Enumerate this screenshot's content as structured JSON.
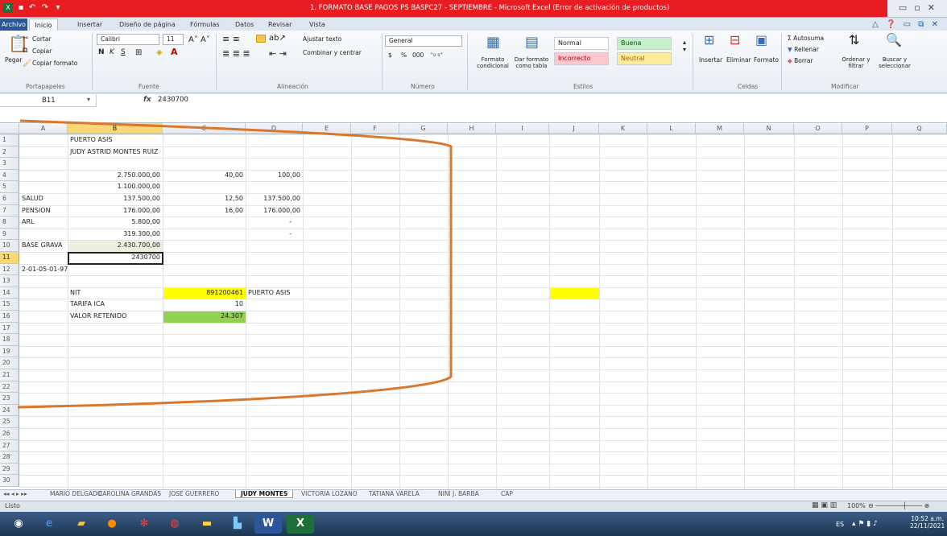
{
  "title": "1. FORMATO BASE PAGOS PS BASPC27 - SEPTIEMBRE  -  Microsoft Excel (Error de activación de productos)",
  "tabs": [
    "Archivo",
    "Inicio",
    "Insertar",
    "Diseño de página",
    "Fórmulas",
    "Datos",
    "Revisar",
    "Vista"
  ],
  "ribbon": {
    "clipboard": {
      "paste": "Pegar",
      "cut": "Cortar",
      "copy": "Copiar",
      "format_painter": "Copiar formato",
      "label": "Portapapeles"
    },
    "font": {
      "name": "Calibri",
      "size": "11",
      "label": "Fuente",
      "bold": "N",
      "italic": "K",
      "underline": "S"
    },
    "alignment": {
      "wrap": "Ajustar texto",
      "merge": "Combinar y centrar",
      "label": "Alineación"
    },
    "number": {
      "format": "General",
      "currency": "$",
      "percent": "%",
      "thousands": "000",
      "label": "Número"
    },
    "styles": {
      "cond_format": "Formato condicional",
      "as_table": "Dar formato como tabla",
      "normal": "Normal",
      "good": "Buena",
      "bad": "Incorrecto",
      "neutral": "Neutral",
      "label": "Estilos"
    },
    "cells": {
      "insert": "Insertar",
      "delete": "Eliminar",
      "format": "Formato",
      "label": "Celdas"
    },
    "editing": {
      "autosum": "Autosuma",
      "fill": "Rellenar",
      "clear": "Borrar",
      "sort": "Ordenar y filtrar",
      "find": "Buscar y seleccionar",
      "label": "Modificar"
    }
  },
  "formula_bar": {
    "namebox": "B11",
    "fx": "fx",
    "content": "2430700"
  },
  "columns": [
    "A",
    "B",
    "C",
    "D",
    "E",
    "F",
    "G",
    "H",
    "I",
    "J",
    "K",
    "L",
    "M",
    "N",
    "O",
    "P",
    "Q"
  ],
  "rows": [
    "1",
    "2",
    "3",
    "4",
    "5",
    "6",
    "7",
    "8",
    "9",
    "10",
    "11",
    "12",
    "13",
    "14",
    "15",
    "16",
    "17",
    "18",
    "19",
    "20",
    "21",
    "22",
    "23",
    "24",
    "25",
    "26",
    "27",
    "28",
    "29",
    "30"
  ],
  "cells": {
    "B1": "PUERTO ASIS",
    "B2": "JUDY ASTRID MONTES RUIZ",
    "B4": "2.750.000,00",
    "C4": "40,00",
    "D4": "100,00",
    "B5": "1.100.000,00",
    "A6": "SALUD",
    "B6": "137.500,00",
    "C6": "12,50",
    "D6": "137.500,00",
    "A7": "PENSION",
    "B7": "176.000,00",
    "C7": "16,00",
    "D7": "176.000,00",
    "A8": "ARL",
    "B8": "5.800,00",
    "D8": "-",
    "B9": "319.300,00",
    "D9": "-",
    "A10": "BASE GRAVA",
    "B10": "2.430.700,00",
    "B11": "2430700",
    "A12": "2-01-05-01-97",
    "B14": "NIT",
    "C14": "891200461",
    "D14": "PUERTO ASIS",
    "B15": "TARIFA ICA",
    "C15": "10",
    "B16": "VALOR RETENIDO",
    "C16": "24.307"
  },
  "colors": {
    "yellow": "#ffff00",
    "green": "#92d050",
    "light_green": "#ebf1de",
    "annotation": "#d9782c",
    "title": "#e81d22"
  },
  "sheet_tabs": [
    "MARIO DELGADO",
    "CAROLINA GRANDAS",
    "JOSE GUERRERO",
    "JUDY MONTES",
    "VICTORIA LOZANO",
    "TATIANA VARELA",
    "NINI J. BARBA",
    "CAP"
  ],
  "status": {
    "ready": "Listo",
    "zoom": "100%"
  },
  "taskbar": {
    "lang": "ES",
    "time": "10:52 a.m.",
    "date": "22/11/2021"
  }
}
